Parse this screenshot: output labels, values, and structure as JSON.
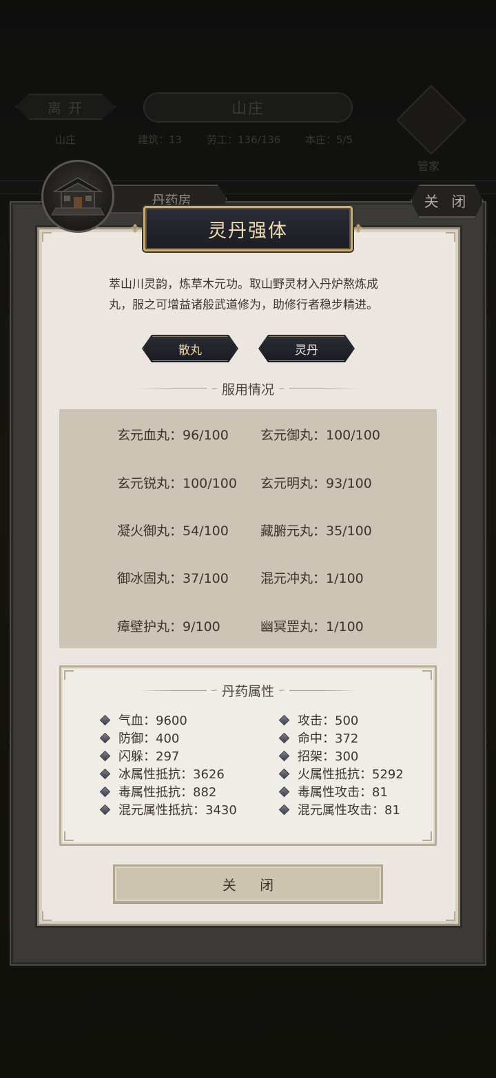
{
  "background": {
    "leave_label": "离 开",
    "title": "山庄",
    "subtitle": "山庄",
    "stats": [
      "建筑：13",
      "劳工：136/136",
      "本庄：5/5"
    ],
    "steward_label": "管家"
  },
  "room_tab": "丹药房",
  "top_close_label": "关 闭",
  "dialog": {
    "title": "灵丹强体",
    "description": "萃山川灵韵，炼草木元功。取山野灵材入丹炉熬炼成丸，服之可增益诸般武道修为，助修行者稳步精进。",
    "tabs": [
      "散丸",
      "灵丹"
    ],
    "usage_heading": "服用情况",
    "usage": [
      "玄元血丸：96/100",
      "玄元御丸：100/100",
      "玄元锐丸：100/100",
      "玄元明丸：93/100",
      "凝火御丸：54/100",
      "藏腑元丸：35/100",
      "御冰固丸：37/100",
      "混元冲丸：1/100",
      "瘴壁护丸：9/100",
      "幽冥罡丸：1/100"
    ],
    "attr_heading": "丹药属性",
    "attributes": [
      "气血：9600",
      "攻击：500",
      "防御：400",
      "命中：372",
      "闪躲：297",
      "招架：300",
      "冰属性抵抗：3626",
      "火属性抵抗：5292",
      "毒属性抵抗：882",
      "毒属性攻击：81",
      "混元属性抵抗：3430",
      "混元属性攻击：81"
    ],
    "close_label": "关 闭"
  },
  "colors": {
    "panel": "#ebe6df",
    "usage_bg": "#cdc4b5",
    "banner_text": "#efdcb0",
    "gold_border": "#c9ae7a"
  }
}
